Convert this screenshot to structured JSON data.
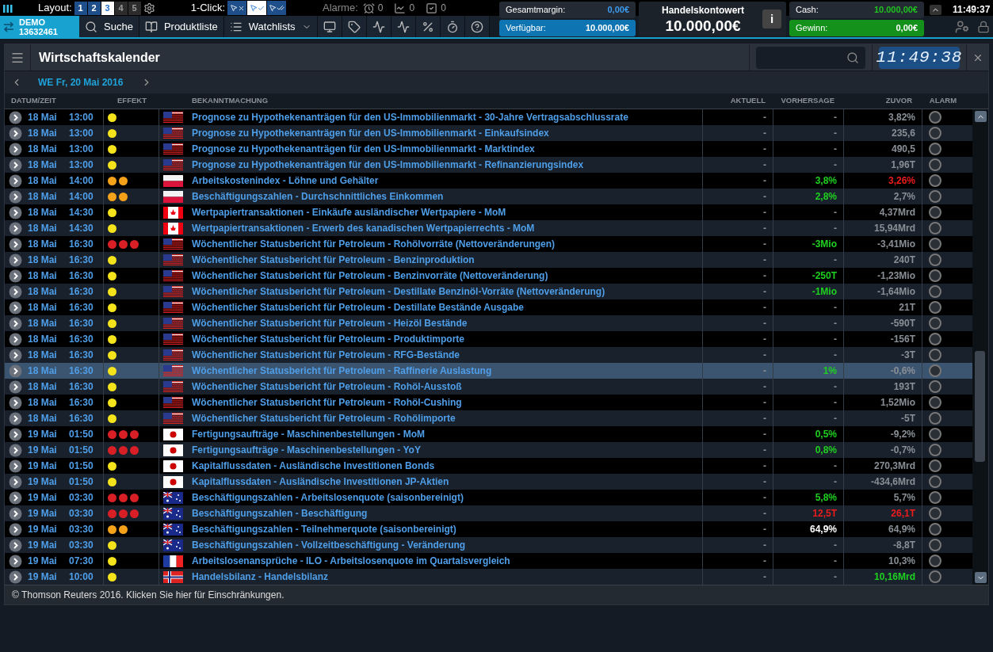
{
  "topbar": {
    "layout_label": "Layout:",
    "layouts": [
      {
        "label": "1",
        "selected": false,
        "disabled": false
      },
      {
        "label": "2",
        "selected": false,
        "disabled": false
      },
      {
        "label": "3",
        "selected": true,
        "disabled": false
      },
      {
        "label": "4",
        "selected": false,
        "disabled": true
      },
      {
        "label": "5",
        "selected": false,
        "disabled": true
      }
    ],
    "oneclick_label": "1-Click:",
    "oneclick_modes": [
      {
        "kind": "off",
        "selected": false
      },
      {
        "kind": "single",
        "selected": true
      },
      {
        "kind": "double",
        "selected": false
      }
    ],
    "alarms_label": "Alarme:",
    "alarm_counters": [
      {
        "kind": "clock",
        "count": "0"
      },
      {
        "kind": "chart",
        "count": "0"
      },
      {
        "kind": "check",
        "count": "0"
      }
    ]
  },
  "account": {
    "mode": "DEMO",
    "number": "13632461"
  },
  "nav": [
    {
      "kind": "search",
      "label": "Suche"
    },
    {
      "kind": "book",
      "label": "Produktliste"
    },
    {
      "kind": "list",
      "label": "Watchlists"
    }
  ],
  "balances": {
    "margin_label": "Gesamtmargin:",
    "margin_value": "0,00€",
    "available_label": "Verfügbar:",
    "available_value": "10.000,00€",
    "account_title": "Handelskontowert",
    "account_value": "10.000,00€",
    "info_label": "i",
    "cash_label": "Cash:",
    "cash_value": "10.000,00€",
    "profit_label": "Gewinn:",
    "profit_value": "0,00€"
  },
  "clock": "11:49:37",
  "panel": {
    "title": "Wirtschaftskalender",
    "clock": "11:49:38",
    "date": "WE Fr, 20 Mai 2016",
    "columns": [
      "DATUM/ZEIT",
      "EFFEKT",
      "BEKANNTMACHUNG",
      "AKTUELL",
      "VORHERSAGE",
      "ZUVOR",
      "ALARM"
    ],
    "rows": [
      {
        "date": "18 Mai",
        "time": "13:00",
        "effect": [
          {
            "color": "#f5e31b"
          }
        ],
        "flag": {
          "kind": "us"
        },
        "title": "Prognose zu Hypothekenanträgen für den US-Immobilienmarkt - 30-Jahre Vertragsabschlussrate",
        "actual": "-",
        "forecast": {
          "text": "-",
          "kind": "plain"
        },
        "previous": {
          "text": "3,82%",
          "kind": "plain"
        },
        "selected": false,
        "alarm": false
      },
      {
        "date": "18 Mai",
        "time": "13:00",
        "effect": [
          {
            "color": "#f5e31b"
          }
        ],
        "flag": {
          "kind": "us"
        },
        "title": "Prognose zu Hypothekenanträgen für den US-Immobilienmarkt - Einkaufsindex",
        "actual": "-",
        "forecast": {
          "text": "-",
          "kind": "plain"
        },
        "previous": {
          "text": "235,6",
          "kind": "plain"
        },
        "selected": false,
        "alarm": false
      },
      {
        "date": "18 Mai",
        "time": "13:00",
        "effect": [
          {
            "color": "#f5e31b"
          }
        ],
        "flag": {
          "kind": "us"
        },
        "title": "Prognose zu Hypothekenanträgen für den US-Immobilienmarkt - Marktindex",
        "actual": "-",
        "forecast": {
          "text": "-",
          "kind": "plain"
        },
        "previous": {
          "text": "490,5",
          "kind": "plain"
        },
        "selected": false,
        "alarm": false
      },
      {
        "date": "18 Mai",
        "time": "13:00",
        "effect": [
          {
            "color": "#f5e31b"
          }
        ],
        "flag": {
          "kind": "us"
        },
        "title": "Prognose zu Hypothekenanträgen für den US-Immobilienmarkt - Refinanzierungsindex",
        "actual": "-",
        "forecast": {
          "text": "-",
          "kind": "plain"
        },
        "previous": {
          "text": "1,96T",
          "kind": "plain"
        },
        "selected": false,
        "alarm": false
      },
      {
        "date": "18 Mai",
        "time": "14:00",
        "effect": [
          {
            "color": "#f5a21b"
          },
          {
            "color": "#f5a21b"
          }
        ],
        "flag": {
          "kind": "pl"
        },
        "title": "Arbeitskostenindex - Löhne und Gehälter",
        "actual": "-",
        "forecast": {
          "text": "3,8%",
          "kind": "better"
        },
        "previous": {
          "text": "3,26%",
          "kind": "worse"
        },
        "selected": false,
        "alarm": false
      },
      {
        "date": "18 Mai",
        "time": "14:00",
        "effect": [
          {
            "color": "#f5a21b"
          },
          {
            "color": "#f5a21b"
          }
        ],
        "flag": {
          "kind": "pl"
        },
        "title": "Beschäftigungszahlen - Durchschnittliches Einkommen",
        "actual": "-",
        "forecast": {
          "text": "2,8%",
          "kind": "better"
        },
        "previous": {
          "text": "2,7%",
          "kind": "plain"
        },
        "selected": false,
        "alarm": false
      },
      {
        "date": "18 Mai",
        "time": "14:30",
        "effect": [
          {
            "color": "#f5e31b"
          }
        ],
        "flag": {
          "kind": "ca"
        },
        "title": "Wertpapiertransaktionen - Einkäufe ausländischer Wertpapiere - MoM",
        "actual": "-",
        "forecast": {
          "text": "-",
          "kind": "plain"
        },
        "previous": {
          "text": "4,37Mrd",
          "kind": "plain"
        },
        "selected": false,
        "alarm": false
      },
      {
        "date": "18 Mai",
        "time": "14:30",
        "effect": [
          {
            "color": "#f5e31b"
          }
        ],
        "flag": {
          "kind": "ca"
        },
        "title": "Wertpapiertransaktionen - Erwerb des kanadischen Wertpapierrechts - MoM",
        "actual": "-",
        "forecast": {
          "text": "-",
          "kind": "plain"
        },
        "previous": {
          "text": "15,94Mrd",
          "kind": "plain"
        },
        "selected": false,
        "alarm": false
      },
      {
        "date": "18 Mai",
        "time": "16:30",
        "effect": [
          {
            "color": "#d91f26"
          },
          {
            "color": "#d91f26"
          },
          {
            "color": "#d91f26"
          }
        ],
        "flag": {
          "kind": "us"
        },
        "title": "Wöchentlicher Statusbericht für Petroleum - Rohölvorräte (Nettoveränderungen)",
        "actual": "-",
        "forecast": {
          "text": "-3Mio",
          "kind": "better"
        },
        "previous": {
          "text": "-3,41Mio",
          "kind": "plain"
        },
        "selected": false,
        "alarm": false
      },
      {
        "date": "18 Mai",
        "time": "16:30",
        "effect": [
          {
            "color": "#f5e31b"
          }
        ],
        "flag": {
          "kind": "us"
        },
        "title": "Wöchentlicher Statusbericht für Petroleum - Benzinproduktion",
        "actual": "-",
        "forecast": {
          "text": "-",
          "kind": "plain"
        },
        "previous": {
          "text": "240T",
          "kind": "plain"
        },
        "selected": false,
        "alarm": false
      },
      {
        "date": "18 Mai",
        "time": "16:30",
        "effect": [
          {
            "color": "#f5e31b"
          }
        ],
        "flag": {
          "kind": "us"
        },
        "title": "Wöchentlicher Statusbericht für Petroleum - Benzinvorräte (Nettoveränderung)",
        "actual": "-",
        "forecast": {
          "text": "-250T",
          "kind": "better"
        },
        "previous": {
          "text": "-1,23Mio",
          "kind": "plain"
        },
        "selected": false,
        "alarm": false
      },
      {
        "date": "18 Mai",
        "time": "16:30",
        "effect": [
          {
            "color": "#f5e31b"
          }
        ],
        "flag": {
          "kind": "us"
        },
        "title": "Wöchentlicher Statusbericht für Petroleum - Destillate Benzinöl-Vorräte (Nettoveränderung)",
        "actual": "-",
        "forecast": {
          "text": "-1Mio",
          "kind": "better"
        },
        "previous": {
          "text": "-1,64Mio",
          "kind": "plain"
        },
        "selected": false,
        "alarm": false
      },
      {
        "date": "18 Mai",
        "time": "16:30",
        "effect": [
          {
            "color": "#f5e31b"
          }
        ],
        "flag": {
          "kind": "us"
        },
        "title": "Wöchentlicher Statusbericht für Petroleum - Destillate Bestände Ausgabe",
        "actual": "-",
        "forecast": {
          "text": "-",
          "kind": "plain"
        },
        "previous": {
          "text": "21T",
          "kind": "plain"
        },
        "selected": false,
        "alarm": false
      },
      {
        "date": "18 Mai",
        "time": "16:30",
        "effect": [
          {
            "color": "#f5e31b"
          }
        ],
        "flag": {
          "kind": "us"
        },
        "title": "Wöchentlicher Statusbericht für Petroleum - Heizöl Bestände",
        "actual": "-",
        "forecast": {
          "text": "-",
          "kind": "plain"
        },
        "previous": {
          "text": "-590T",
          "kind": "plain"
        },
        "selected": false,
        "alarm": false
      },
      {
        "date": "18 Mai",
        "time": "16:30",
        "effect": [
          {
            "color": "#f5e31b"
          }
        ],
        "flag": {
          "kind": "us"
        },
        "title": "Wöchentlicher Statusbericht für Petroleum - Produktimporte",
        "actual": "-",
        "forecast": {
          "text": "-",
          "kind": "plain"
        },
        "previous": {
          "text": "-156T",
          "kind": "plain"
        },
        "selected": false,
        "alarm": false
      },
      {
        "date": "18 Mai",
        "time": "16:30",
        "effect": [
          {
            "color": "#f5e31b"
          }
        ],
        "flag": {
          "kind": "us"
        },
        "title": "Wöchentlicher Statusbericht für Petroleum - RFG-Bestände",
        "actual": "-",
        "forecast": {
          "text": "-",
          "kind": "plain"
        },
        "previous": {
          "text": "-3T",
          "kind": "plain"
        },
        "selected": false,
        "alarm": false
      },
      {
        "date": "18 Mai",
        "time": "16:30",
        "effect": [
          {
            "color": "#f5e31b"
          }
        ],
        "flag": {
          "kind": "us"
        },
        "title": "Wöchentlicher Statusbericht für Petroleum - Raffinerie Auslastung",
        "actual": "-",
        "forecast": {
          "text": "1%",
          "kind": "better"
        },
        "previous": {
          "text": "-0,6%",
          "kind": "plain"
        },
        "selected": true,
        "alarm": false
      },
      {
        "date": "18 Mai",
        "time": "16:30",
        "effect": [
          {
            "color": "#f5e31b"
          }
        ],
        "flag": {
          "kind": "us"
        },
        "title": "Wöchentlicher Statusbericht für Petroleum - Rohöl-Ausstoß",
        "actual": "-",
        "forecast": {
          "text": "-",
          "kind": "plain"
        },
        "previous": {
          "text": "193T",
          "kind": "plain"
        },
        "selected": false,
        "alarm": false
      },
      {
        "date": "18 Mai",
        "time": "16:30",
        "effect": [
          {
            "color": "#f5e31b"
          }
        ],
        "flag": {
          "kind": "us"
        },
        "title": "Wöchentlicher Statusbericht für Petroleum - Rohöl-Cushing",
        "actual": "-",
        "forecast": {
          "text": "-",
          "kind": "plain"
        },
        "previous": {
          "text": "1,52Mio",
          "kind": "plain"
        },
        "selected": false,
        "alarm": false
      },
      {
        "date": "18 Mai",
        "time": "16:30",
        "effect": [
          {
            "color": "#f5e31b"
          }
        ],
        "flag": {
          "kind": "us"
        },
        "title": "Wöchentlicher Statusbericht für Petroleum - Rohölimporte",
        "actual": "-",
        "forecast": {
          "text": "-",
          "kind": "plain"
        },
        "previous": {
          "text": "-5T",
          "kind": "plain"
        },
        "selected": false,
        "alarm": false
      },
      {
        "date": "19 Mai",
        "time": "01:50",
        "effect": [
          {
            "color": "#d91f26"
          },
          {
            "color": "#d91f26"
          },
          {
            "color": "#d91f26"
          }
        ],
        "flag": {
          "kind": "jp"
        },
        "title": "Fertigungsaufträge - Maschinenbestellungen - MoM",
        "actual": "-",
        "forecast": {
          "text": "0,5%",
          "kind": "better"
        },
        "previous": {
          "text": "-9,2%",
          "kind": "plain"
        },
        "selected": false,
        "alarm": false
      },
      {
        "date": "19 Mai",
        "time": "01:50",
        "effect": [
          {
            "color": "#d91f26"
          },
          {
            "color": "#d91f26"
          },
          {
            "color": "#d91f26"
          }
        ],
        "flag": {
          "kind": "jp"
        },
        "title": "Fertigungsaufträge - Maschinenbestellungen - YoY",
        "actual": "-",
        "forecast": {
          "text": "0,8%",
          "kind": "better"
        },
        "previous": {
          "text": "-0,7%",
          "kind": "plain"
        },
        "selected": false,
        "alarm": false
      },
      {
        "date": "19 Mai",
        "time": "01:50",
        "effect": [
          {
            "color": "#f5e31b"
          }
        ],
        "flag": {
          "kind": "jp"
        },
        "title": "Kapitalflussdaten - Ausländische Investitionen Bonds",
        "actual": "-",
        "forecast": {
          "text": "-",
          "kind": "plain"
        },
        "previous": {
          "text": "270,3Mrd",
          "kind": "plain"
        },
        "selected": false,
        "alarm": false
      },
      {
        "date": "19 Mai",
        "time": "01:50",
        "effect": [
          {
            "color": "#f5e31b"
          }
        ],
        "flag": {
          "kind": "jp"
        },
        "title": "Kapitalflussdaten - Ausländische Investitionen JP-Aktien",
        "actual": "-",
        "forecast": {
          "text": "-",
          "kind": "plain"
        },
        "previous": {
          "text": "-434,6Mrd",
          "kind": "plain"
        },
        "selected": false,
        "alarm": false
      },
      {
        "date": "19 Mai",
        "time": "03:30",
        "effect": [
          {
            "color": "#d91f26"
          },
          {
            "color": "#d91f26"
          },
          {
            "color": "#d91f26"
          }
        ],
        "flag": {
          "kind": "au"
        },
        "title": "Beschäftigungszahlen - Arbeitslosenquote (saisonbereinigt)",
        "actual": "-",
        "forecast": {
          "text": "5,8%",
          "kind": "better"
        },
        "previous": {
          "text": "5,7%",
          "kind": "plain"
        },
        "selected": false,
        "alarm": false
      },
      {
        "date": "19 Mai",
        "time": "03:30",
        "effect": [
          {
            "color": "#d91f26"
          },
          {
            "color": "#d91f26"
          },
          {
            "color": "#d91f26"
          }
        ],
        "flag": {
          "kind": "au"
        },
        "title": "Beschäftigungszahlen - Beschäftigung",
        "actual": "-",
        "forecast": {
          "text": "12,5T",
          "kind": "worse"
        },
        "previous": {
          "text": "26,1T",
          "kind": "worse"
        },
        "selected": false,
        "alarm": false
      },
      {
        "date": "19 Mai",
        "time": "03:30",
        "effect": [
          {
            "color": "#f5a21b"
          },
          {
            "color": "#f5a21b"
          }
        ],
        "flag": {
          "kind": "au"
        },
        "title": "Beschäftigungszahlen - Teilnehmerquote (saisonbereinigt)",
        "actual": "-",
        "forecast": {
          "text": "64,9%",
          "kind": "same"
        },
        "previous": {
          "text": "64,9%",
          "kind": "plain"
        },
        "selected": false,
        "alarm": false
      },
      {
        "date": "19 Mai",
        "time": "03:30",
        "effect": [
          {
            "color": "#f5e31b"
          }
        ],
        "flag": {
          "kind": "au"
        },
        "title": "Beschäftigungszahlen - Vollzeitbeschäftigung - Veränderung",
        "actual": "-",
        "forecast": {
          "text": "-",
          "kind": "plain"
        },
        "previous": {
          "text": "-8,8T",
          "kind": "plain"
        },
        "selected": false,
        "alarm": false
      },
      {
        "date": "19 Mai",
        "time": "07:30",
        "effect": [
          {
            "color": "#f5e31b"
          }
        ],
        "flag": {
          "kind": "fr"
        },
        "title": "Arbeitslosenansprüche - ILO - Arbeitslosenquote im Quartalsvergleich",
        "actual": "-",
        "forecast": {
          "text": "-",
          "kind": "plain"
        },
        "previous": {
          "text": "10,3%",
          "kind": "plain"
        },
        "selected": false,
        "alarm": false
      },
      {
        "date": "19 Mai",
        "time": "10:00",
        "effect": [
          {
            "color": "#f5e31b"
          }
        ],
        "flag": {
          "kind": "no"
        },
        "title": "Handelsbilanz - Handelsbilanz",
        "actual": "-",
        "forecast": {
          "text": "-",
          "kind": "plain"
        },
        "previous": {
          "text": "10,16Mrd",
          "kind": "better"
        },
        "selected": false,
        "alarm": false
      }
    ],
    "footer": "© Thomson Reuters 2016. Klicken Sie hier für Einschränkungen."
  }
}
